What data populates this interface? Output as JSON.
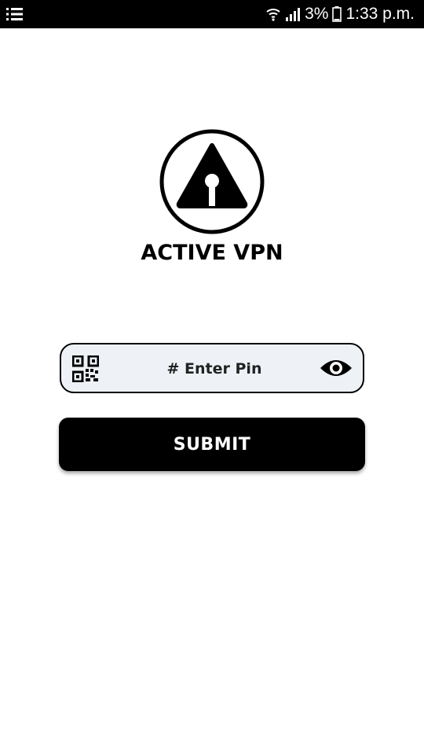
{
  "status_bar": {
    "menu_icon": "list-icon",
    "wifi_icon": "wifi-icon",
    "signal_icon": "signal-icon",
    "battery_percent": "3%",
    "battery_icon": "battery-icon",
    "time": "1:33 p.m."
  },
  "brand": {
    "logo_icon": "keyhole-triangle-logo",
    "name": "ACTIVE VPN"
  },
  "pin_form": {
    "qr_icon": "qr-code-icon",
    "placeholder": "# Enter Pin",
    "value": "",
    "visibility_icon": "eye-icon"
  },
  "submit": {
    "label": "SUBMIT"
  },
  "colors": {
    "primary": "#000000",
    "background": "#ffffff",
    "field_background": "#eef2f7",
    "button_text": "#ffffff"
  }
}
